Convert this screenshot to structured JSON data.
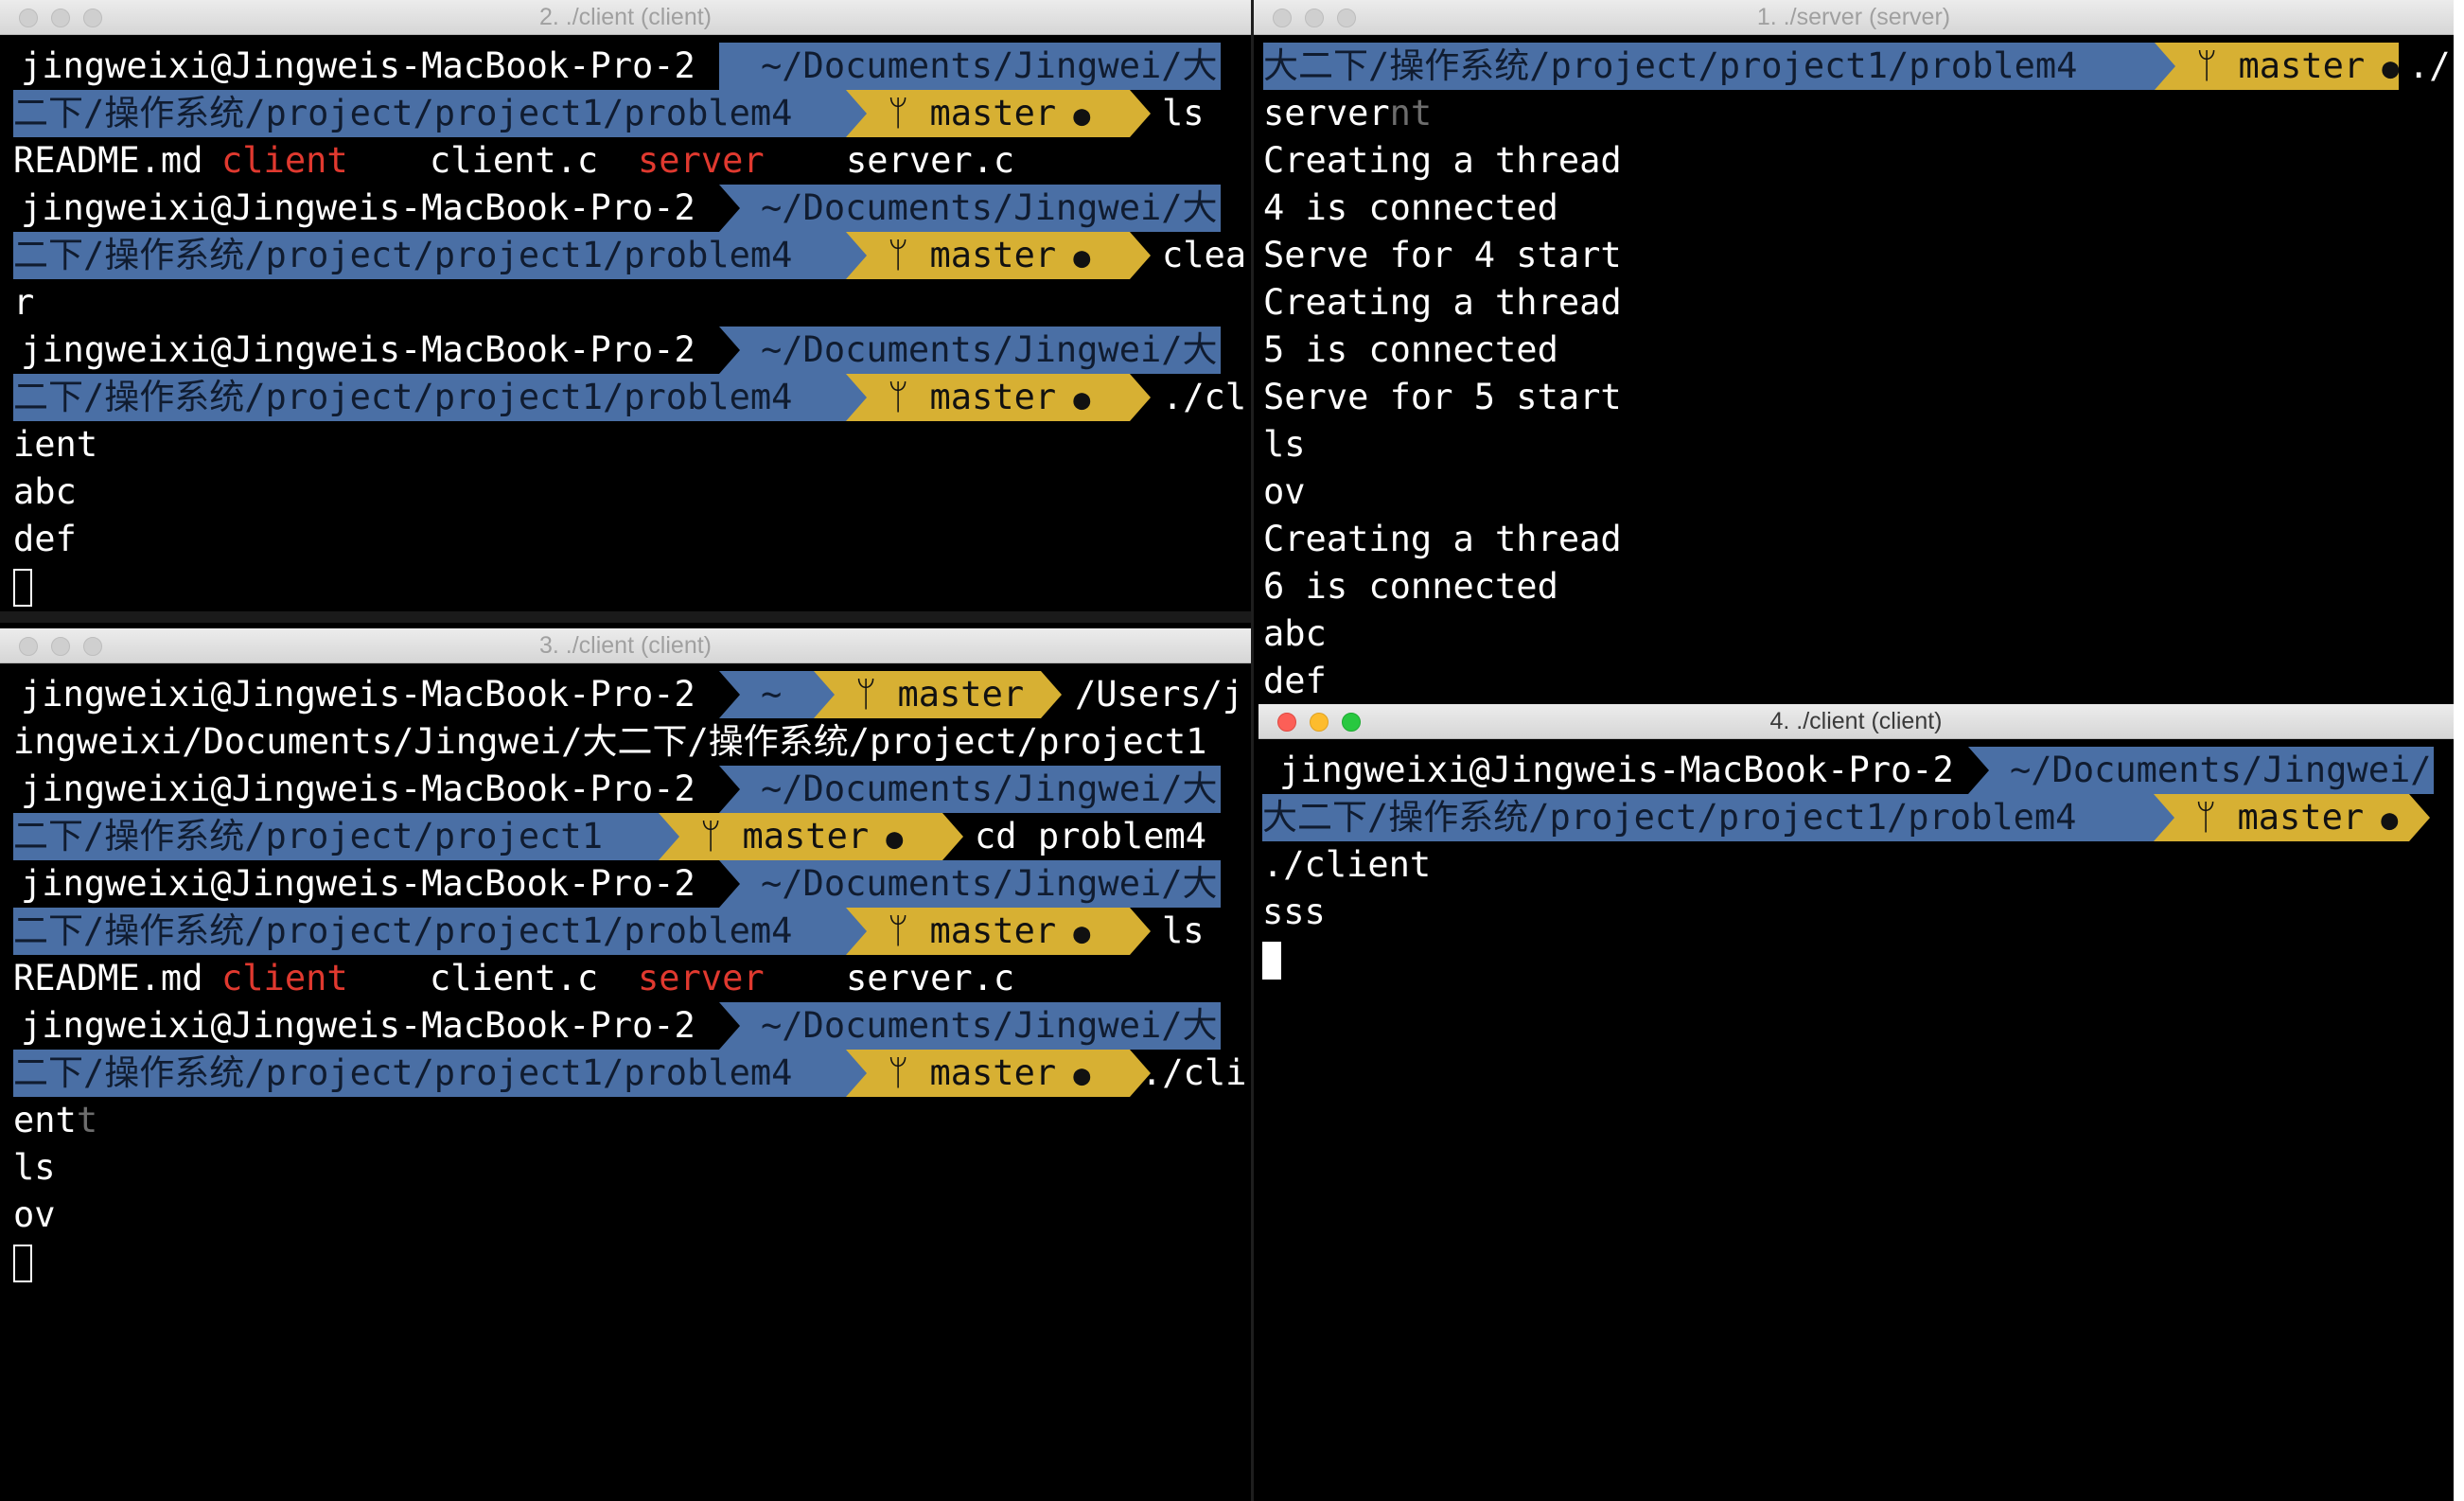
{
  "windows": {
    "w2": {
      "title": "2. ./client (client)"
    },
    "w1": {
      "title": "1. ./server (server)"
    },
    "w3": {
      "title": "3. ./client (client)"
    },
    "w4": {
      "title": "4. ./client (client)"
    }
  },
  "prompt": {
    "user": "jingweixi@Jingweis-MacBook-Pro-2",
    "path_head": "~/Documents/Jingwei/大",
    "path_tail": "二下/操作系统/project/project1/problem4",
    "path_tail_short": "二下/操作系统/project/project1",
    "branch": "master",
    "home": "~",
    "dot": "●",
    "branch_icon": "branch-icon"
  },
  "w2": {
    "cmd1": "ls",
    "ls": [
      "README.md",
      "client",
      "client.c",
      "server",
      "server.c"
    ],
    "cmd2a": "clea",
    "cmd2b": "r",
    "cmd3a": "./cl",
    "cmd3b": "ient",
    "out": [
      "abc",
      "def"
    ]
  },
  "w1": {
    "prompt_path": "大二下/操作系统/project/project1/problem4",
    "cmd_a": "./",
    "cmd_b": "server",
    "cmd_b_dim": "nt",
    "lines": [
      "Creating a thread",
      "4 is connected",
      "Serve for 4 start",
      "Creating a thread",
      "5 is connected",
      "Serve for 5 start",
      "ls",
      "ov",
      "Creating a thread",
      "6 is connected",
      "abc",
      "def"
    ]
  },
  "w3": {
    "cwd_a": "/Users/j",
    "cwd_b": "ingweixi/Documents/Jingwei/大二下/操作系统/project/project1",
    "cmd1": "cd problem4",
    "cmd2": "ls",
    "ls": [
      "README.md",
      "client",
      "client.c",
      "server",
      "server.c"
    ],
    "cmd3a": "./cli",
    "cmd3b": "ent",
    "cmd3b_dim": "t",
    "out": [
      "ls",
      "ov"
    ]
  },
  "w4": {
    "path_head": "~/Documents/Jingwei/",
    "path_tail": "大二下/操作系统/project/project1/problem4",
    "lines": [
      "./client",
      "sss"
    ]
  },
  "colors": {
    "segment_blue": "#4a6fa5",
    "segment_gold": "#d7b033",
    "exe_red": "#e0392f"
  }
}
